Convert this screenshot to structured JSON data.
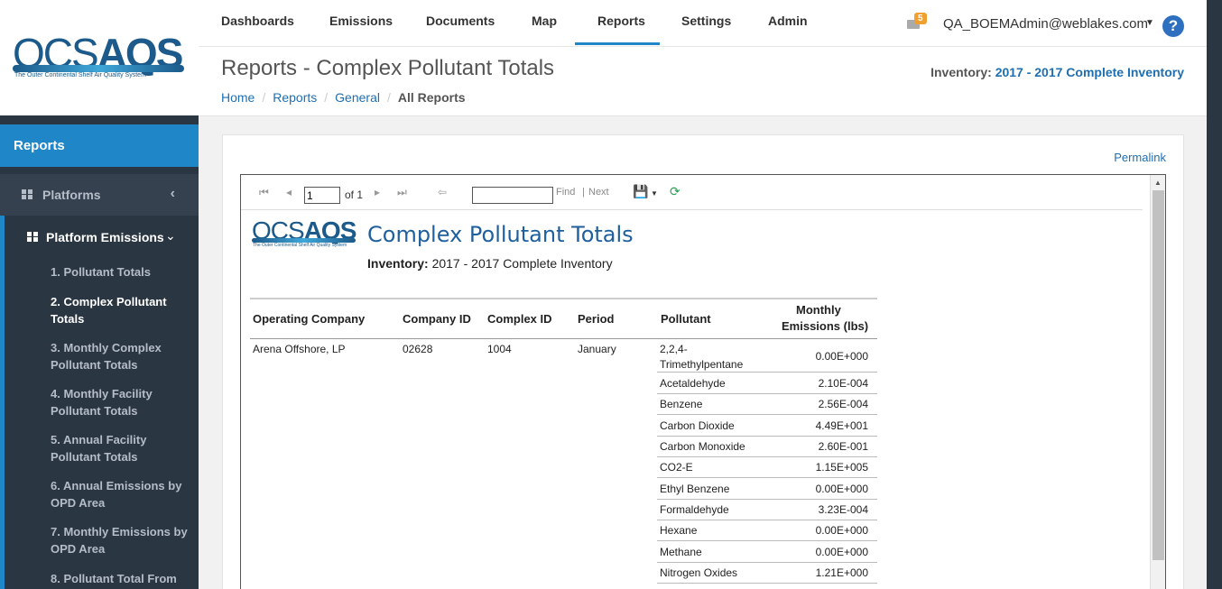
{
  "brand": {
    "logo_main": "OCS",
    "logo_accent": "AQS",
    "logo_tagline": "The Outer Continental Shelf Air Quality System"
  },
  "topnav": {
    "items": [
      "Dashboards",
      "Emissions",
      "Documents",
      "Map",
      "Reports",
      "Settings",
      "Admin"
    ],
    "active": "Reports",
    "mail_count": "5",
    "user": "QA_BOEMAdmin@weblakes.com",
    "help": "?"
  },
  "sidebar": {
    "section": "Reports",
    "platforms": "Platforms",
    "platform_emissions": "Platform Emissions",
    "items": [
      "1. Pollutant Totals",
      "2. Complex Pollutant Totals",
      "3. Monthly Complex Pollutant Totals",
      "4. Monthly Facility Pollutant Totals",
      "5. Annual Facility Pollutant Totals",
      "6. Annual Emissions by OPD Area",
      "7. Monthly Emissions by OPD Area",
      "8. Pollutant Total From"
    ],
    "active_index": 1
  },
  "page": {
    "title": "Reports - Complex Pollutant Totals",
    "inventory_label": "Inventory:",
    "inventory_value": "2017 - 2017 Complete Inventory",
    "breadcrumb": [
      "Home",
      "Reports",
      "General",
      "All Reports"
    ],
    "permalink": "Permalink"
  },
  "viewer": {
    "page_value": "1",
    "of_text": "of 1",
    "find": "Find",
    "sep": "|",
    "next": "Next"
  },
  "report": {
    "title": "Complex Pollutant Totals",
    "inventory_label": "Inventory:",
    "inventory_value": "2017 - 2017 Complete Inventory",
    "headers": {
      "company": "Operating Company",
      "company_id": "Company ID",
      "complex_id": "Complex ID",
      "period": "Period",
      "pollutant": "Pollutant",
      "monthly1": "Monthly",
      "monthly2": "Emissions (lbs)"
    },
    "row": {
      "company": "Arena Offshore, LP",
      "company_id": "02628",
      "complex_id": "1004",
      "period": "January"
    },
    "pollutants": [
      {
        "name": "2,2,4-Trimethylpentane",
        "value": "0.00E+000"
      },
      {
        "name": "Acetaldehyde",
        "value": "2.10E-004"
      },
      {
        "name": "Benzene",
        "value": "2.56E-004"
      },
      {
        "name": "Carbon Dioxide",
        "value": "4.49E+001"
      },
      {
        "name": "Carbon Monoxide",
        "value": "2.60E-001"
      },
      {
        "name": "CO2-E",
        "value": "1.15E+005"
      },
      {
        "name": "Ethyl Benzene",
        "value": "0.00E+000"
      },
      {
        "name": "Formaldehyde",
        "value": "3.23E-004"
      },
      {
        "name": "Hexane",
        "value": "0.00E+000"
      },
      {
        "name": "Methane",
        "value": "0.00E+000"
      },
      {
        "name": "Nitrogen Oxides",
        "value": "1.21E+000"
      }
    ]
  }
}
